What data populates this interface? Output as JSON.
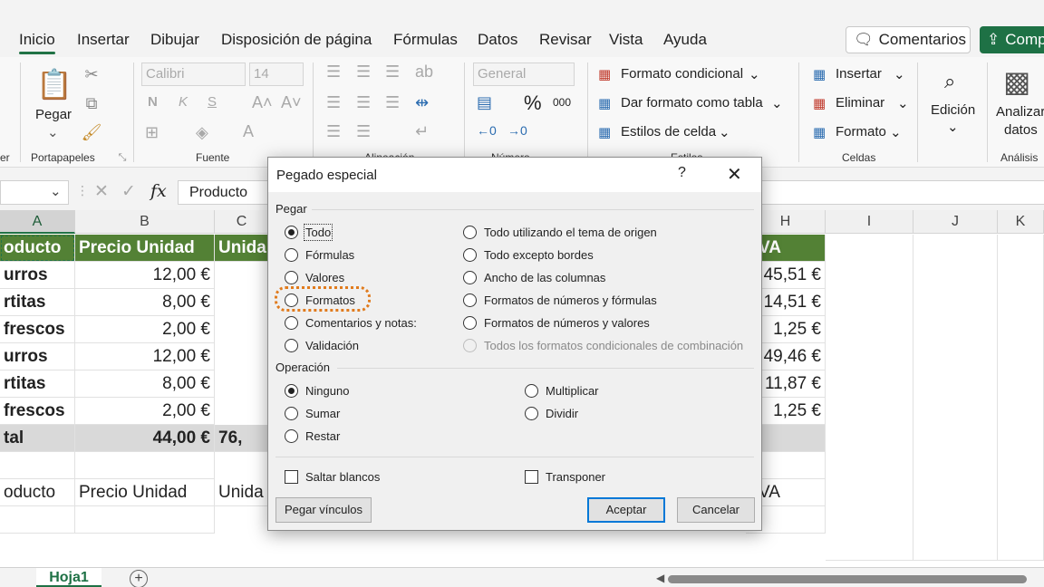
{
  "colors": {
    "accent": "#217346",
    "header_fill": "#538135",
    "total_fill": "#d9d9d9",
    "highlight": "#e07b1d"
  },
  "menu": {
    "tabs": [
      "Inicio",
      "Insertar",
      "Dibujar",
      "Disposición de página",
      "Fórmulas",
      "Datos",
      "Revisar",
      "Vista",
      "Ayuda"
    ],
    "active": "Inicio",
    "comments_label": "Comentarios",
    "share_label": "Comp"
  },
  "ribbon": {
    "clipboard": {
      "paste_label": "Pegar",
      "group_label": "Portapapeles"
    },
    "font": {
      "name": "Calibri",
      "size": "14",
      "bold": "N",
      "italic": "K",
      "underline": "S",
      "group_label": "Fuente"
    },
    "alignment": {
      "group_label": "Alineación"
    },
    "number": {
      "format": "General",
      "group_label": "Número",
      "percent": "%",
      "thousands": "000"
    },
    "styles": {
      "conditional": "Formato condicional",
      "table": "Dar formato como tabla",
      "cell_styles": "Estilos de celda",
      "group_label": "Estilos"
    },
    "cells": {
      "insert": "Insertar",
      "delete": "Eliminar",
      "format": "Formato",
      "group_label": "Celdas"
    },
    "editing": {
      "label": "Edición"
    },
    "analysis": {
      "label_line1": "Analizar",
      "label_line2": "datos",
      "group_label": "Análisis"
    },
    "left_partial_label": "er"
  },
  "formula_bar": {
    "fx": "fx",
    "content": "Producto"
  },
  "grid": {
    "columns": [
      "A",
      "B",
      "C",
      "H",
      "I",
      "J",
      "K"
    ],
    "rows": [
      [
        "oducto",
        "Precio Unidad",
        "Unida",
        "VA"
      ],
      [
        "urros",
        "12,00 €",
        "",
        "45,51 €"
      ],
      [
        "rtitas",
        "8,00 €",
        "",
        "14,51 €"
      ],
      [
        "frescos",
        "2,00 €",
        "",
        "1,25 €"
      ],
      [
        "urros",
        "12,00 €",
        "",
        "49,46 €"
      ],
      [
        "rtitas",
        "8,00 €",
        "",
        "11,87 €"
      ],
      [
        "frescos",
        "2,00 €",
        "",
        "1,25 €"
      ],
      [
        "tal",
        "44,00 €",
        "76,",
        ""
      ],
      [
        "",
        "",
        "",
        ""
      ],
      [
        "oducto",
        "Precio Unidad",
        "Unida",
        "VA"
      ]
    ]
  },
  "sheets": {
    "active": "Hoja1",
    "add": "+"
  },
  "dialog": {
    "title": "Pegado especial",
    "help": "?",
    "close": "✕",
    "paste_section": "Pegar",
    "paste_left": [
      "Todo",
      "Fórmulas",
      "Valores",
      "Formatos",
      "Comentarios y notas:",
      "Validación"
    ],
    "paste_right": [
      "Todo utilizando el tema de origen",
      "Todo excepto bordes",
      "Ancho de las columnas",
      "Formatos de números y fórmulas",
      "Formatos de números y valores",
      "Todos los formatos condicionales de combinación"
    ],
    "operation_section": "Operación",
    "operation_left": [
      "Ninguno",
      "Sumar",
      "Restar"
    ],
    "operation_right": [
      "Multiplicar",
      "Dividir"
    ],
    "skip_blanks": "Saltar blancos",
    "transpose": "Transponer",
    "paste_links": "Pegar vínculos",
    "ok": "Aceptar",
    "cancel": "Cancelar"
  }
}
